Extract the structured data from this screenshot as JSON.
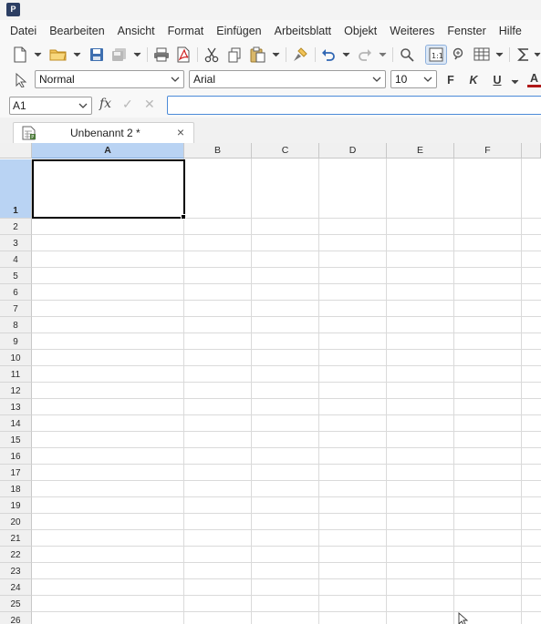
{
  "app": {
    "icon_letter": "P"
  },
  "menubar": {
    "items": [
      "Datei",
      "Bearbeiten",
      "Ansicht",
      "Format",
      "Einfügen",
      "Arbeitsblatt",
      "Objekt",
      "Weiteres",
      "Fenster",
      "Hilfe"
    ]
  },
  "toolbar": {
    "icons": [
      "new-document-icon",
      "open-folder-icon",
      "save-icon",
      "save-all-icon",
      "print-icon",
      "export-pdf-icon",
      "cut-icon",
      "copy-icon",
      "paste-icon",
      "format-painter-icon",
      "undo-icon",
      "redo-icon",
      "search-icon",
      "page-layout-icon",
      "zoom-icon",
      "table-icon",
      "sum-icon"
    ]
  },
  "formatbar": {
    "style": "Normal",
    "font": "Arial",
    "size": "10",
    "bold": "F",
    "italic": "K",
    "underline": "U",
    "font_color": "A"
  },
  "formula": {
    "cell_ref": "A1",
    "fx": "fx",
    "confirm": "✓",
    "cancel": "✕",
    "content": ""
  },
  "document_tab": {
    "title": "Unbenannt 2 *",
    "close": "×"
  },
  "sheet": {
    "columns": [
      "A",
      "B",
      "C",
      "D",
      "E",
      "F"
    ],
    "rows": [
      "1",
      "2",
      "3",
      "4",
      "5",
      "6",
      "7",
      "8",
      "9",
      "10",
      "11",
      "12",
      "13",
      "14",
      "15",
      "16",
      "17",
      "18",
      "19",
      "20",
      "21",
      "22",
      "23",
      "24",
      "25",
      "26"
    ],
    "selected_cell": "A1"
  },
  "colors": {
    "accent": "#4c8bd8",
    "selection_header": "#b9d3f3",
    "grid_line": "#dadada"
  }
}
